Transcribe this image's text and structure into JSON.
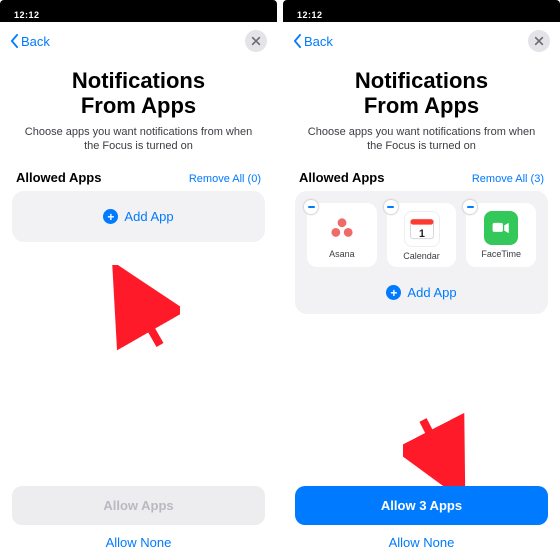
{
  "status": {
    "time": "12:12"
  },
  "nav": {
    "back_label": "Back"
  },
  "page": {
    "title_l1": "Notifications",
    "title_l2": "From Apps",
    "subtitle": "Choose apps you want notifications from when the Focus is turned on"
  },
  "section": {
    "heading": "Allowed Apps",
    "remove_label_left": "Remove All (0)",
    "remove_label_right": "Remove All (3)"
  },
  "add": {
    "label": "Add App"
  },
  "apps": {
    "asana": "Asana",
    "calendar": "Calendar",
    "facetime": "FaceTime"
  },
  "footer": {
    "allow_disabled": "Allow Apps",
    "allow_enabled": "Allow 3 Apps",
    "allow_none": "Allow None"
  },
  "colors": {
    "ios_blue": "#007AFF",
    "facetime": "#34C759"
  }
}
